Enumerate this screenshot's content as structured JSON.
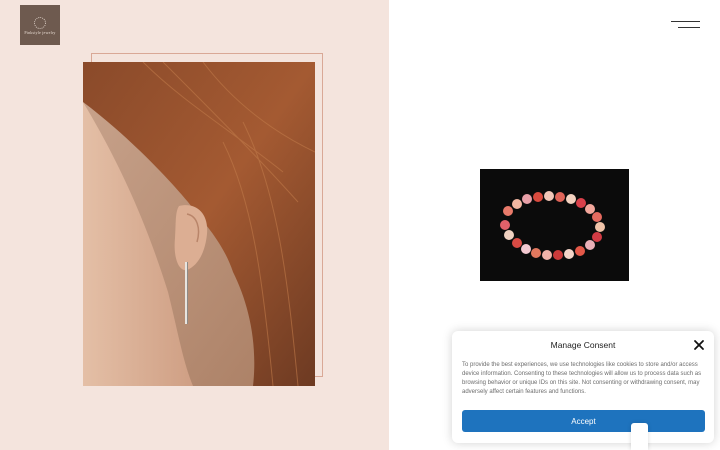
{
  "header": {
    "logo_text": "Pinkstyle jewelry",
    "menu_icon": "hamburger-icon"
  },
  "hero": {
    "description": "model-earring-photo"
  },
  "product": {
    "description": "beaded-bracelet-photo"
  },
  "consent": {
    "title": "Manage Consent",
    "body": "To provide the best experiences, we use technologies like cookies to store and/or access device information. Consenting to these technologies will allow us to process data such as browsing behavior or unique IDs on this site. Not consenting or withdrawing consent, may adversely affect certain features and functions.",
    "accept_label": "Accept",
    "close_icon": "close-icon"
  },
  "colors": {
    "left_panel_bg": "#f4e4dd",
    "logo_bg": "#6e5a4f",
    "frame_outline": "#d9a896",
    "accept_button": "#1e73be"
  }
}
